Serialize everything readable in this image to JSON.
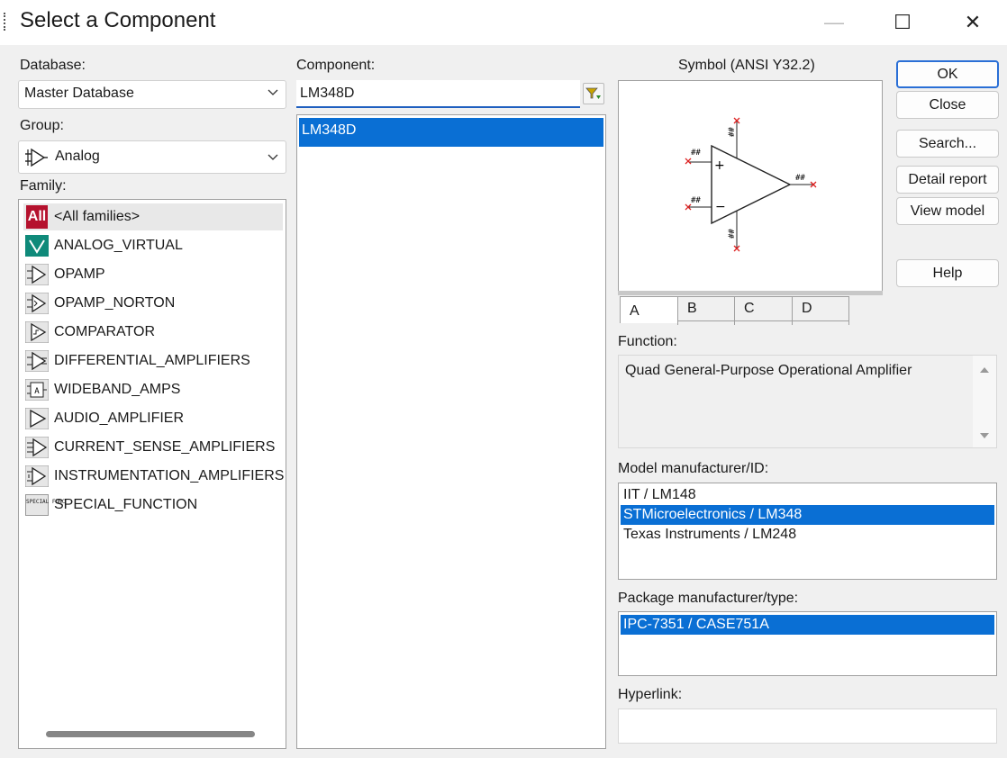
{
  "window": {
    "title": "Select a Component"
  },
  "titlebar": {
    "minimize": "—",
    "maximize": "☐",
    "close": "✕"
  },
  "database": {
    "label": "Database:",
    "value": "Master Database"
  },
  "group": {
    "label": "Group:",
    "value": "Analog",
    "icon": "opamp-icon"
  },
  "family": {
    "label": "Family:",
    "items": [
      {
        "label": "<All families>",
        "icon": "all-families-icon",
        "selected": true
      },
      {
        "label": "ANALOG_VIRTUAL",
        "icon": "analog-virtual-icon"
      },
      {
        "label": "OPAMP",
        "icon": "opamp-icon"
      },
      {
        "label": "OPAMP_NORTON",
        "icon": "opamp-norton-icon"
      },
      {
        "label": "COMPARATOR",
        "icon": "comparator-icon"
      },
      {
        "label": "DIFFERENTIAL_AMPLIFIERS",
        "icon": "differential-amplifier-icon"
      },
      {
        "label": "WIDEBAND_AMPS",
        "icon": "wideband-amp-icon"
      },
      {
        "label": "AUDIO_AMPLIFIER",
        "icon": "audio-amplifier-icon"
      },
      {
        "label": "CURRENT_SENSE_AMPLIFIERS",
        "icon": "current-sense-icon"
      },
      {
        "label": "INSTRUMENTATION_AMPLIFIERS",
        "icon": "instrumentation-amp-icon"
      },
      {
        "label": "SPECIAL_FUNCTION",
        "icon": "special-function-icon"
      }
    ],
    "all_badge": "All",
    "special_badge": "SPECIAL FUNC"
  },
  "component": {
    "label": "Component:",
    "search_value": "LM348D",
    "items": [
      {
        "label": "LM348D",
        "selected": true
      }
    ]
  },
  "symbol": {
    "label": "Symbol (ANSI Y32.2)",
    "pin_marks": {
      "plus": "+",
      "minus": "−",
      "hash": "##"
    },
    "tabs": [
      "A",
      "B",
      "C",
      "D"
    ],
    "active_tab": "A"
  },
  "buttons": {
    "ok": "OK",
    "close": "Close",
    "search": "Search...",
    "detail_report": "Detail report",
    "view_model": "View model",
    "help": "Help"
  },
  "function": {
    "label": "Function:",
    "text": "Quad General-Purpose Operational Amplifier"
  },
  "model": {
    "label": "Model manufacturer/ID:",
    "items": [
      {
        "label": "IIT / LM148",
        "selected": false
      },
      {
        "label": "STMicroelectronics / LM348",
        "selected": true
      },
      {
        "label": "Texas Instruments / LM248",
        "selected": false
      }
    ]
  },
  "package": {
    "label": "Package manufacturer/type:",
    "items": [
      {
        "label": "IPC-7351 / CASE751A",
        "selected": true
      }
    ]
  },
  "hyperlink": {
    "label": "Hyperlink:",
    "value": ""
  },
  "colors": {
    "selection": "#0a6fd4",
    "accent": "#2a6fd6",
    "all_badge": "#b5122e",
    "analog_virtual": "#0f8a7a"
  }
}
